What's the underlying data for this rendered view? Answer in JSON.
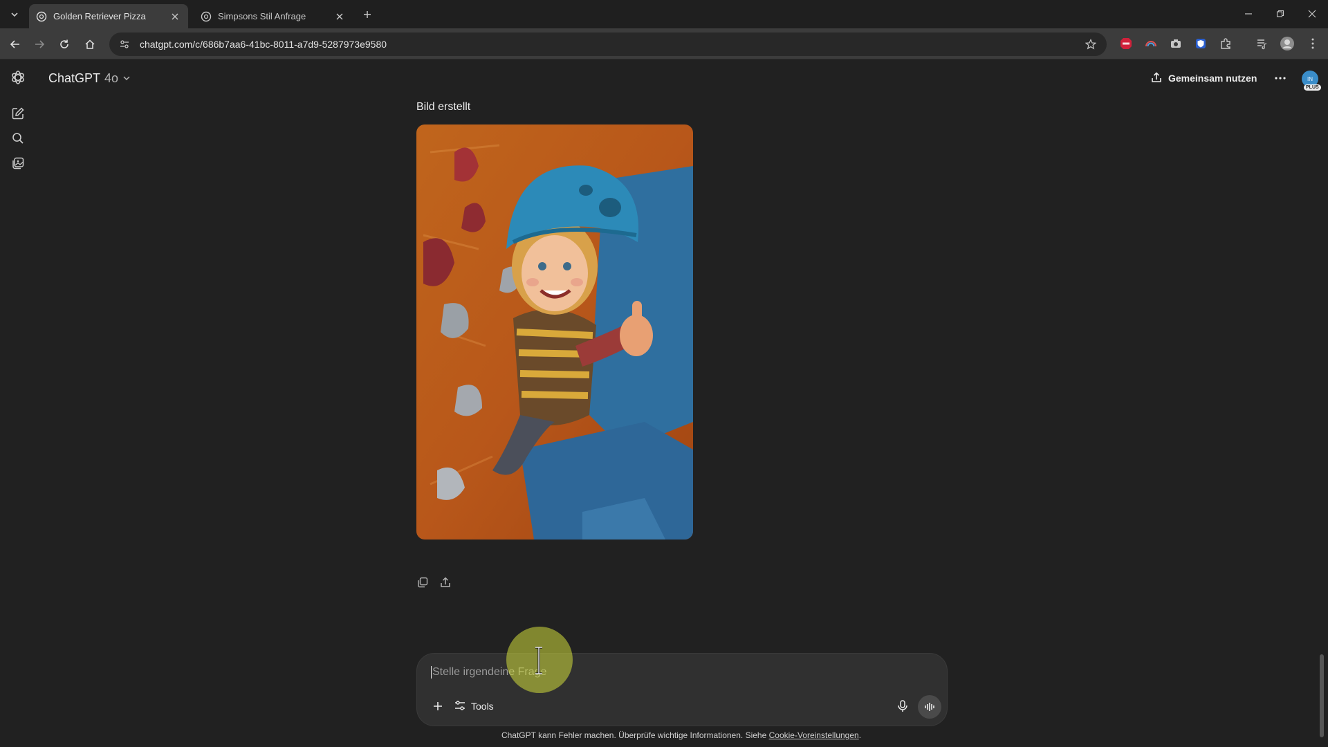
{
  "browser": {
    "tabs": [
      {
        "title": "Golden Retriever Pizza",
        "active": true
      },
      {
        "title": "Simpsons Stil Anfrage",
        "active": false
      }
    ],
    "url": "chatgpt.com/c/686b7aa6-41bc-8011-a7d9-5287973e9580"
  },
  "header": {
    "model_name": "ChatGPT",
    "model_version": "4o",
    "share_label": "Gemeinsam nutzen",
    "avatar_initials": "IN",
    "plan_badge": "PLUS"
  },
  "conversation": {
    "image_caption": "Bild erstellt",
    "image_description_icon": "generated-image"
  },
  "composer": {
    "placeholder": "Stelle irgendeine Frage",
    "tools_label": "Tools"
  },
  "footer": {
    "notice": "ChatGPT kann Fehler machen. Überprüfe wichtige Informationen. Siehe ",
    "link": "Cookie-Voreinstellungen",
    "suffix": "."
  },
  "colors": {
    "background": "#212121",
    "composer": "#303030",
    "avatar": "#3a8dc9",
    "cursor_highlight": "#d2dc3c"
  }
}
